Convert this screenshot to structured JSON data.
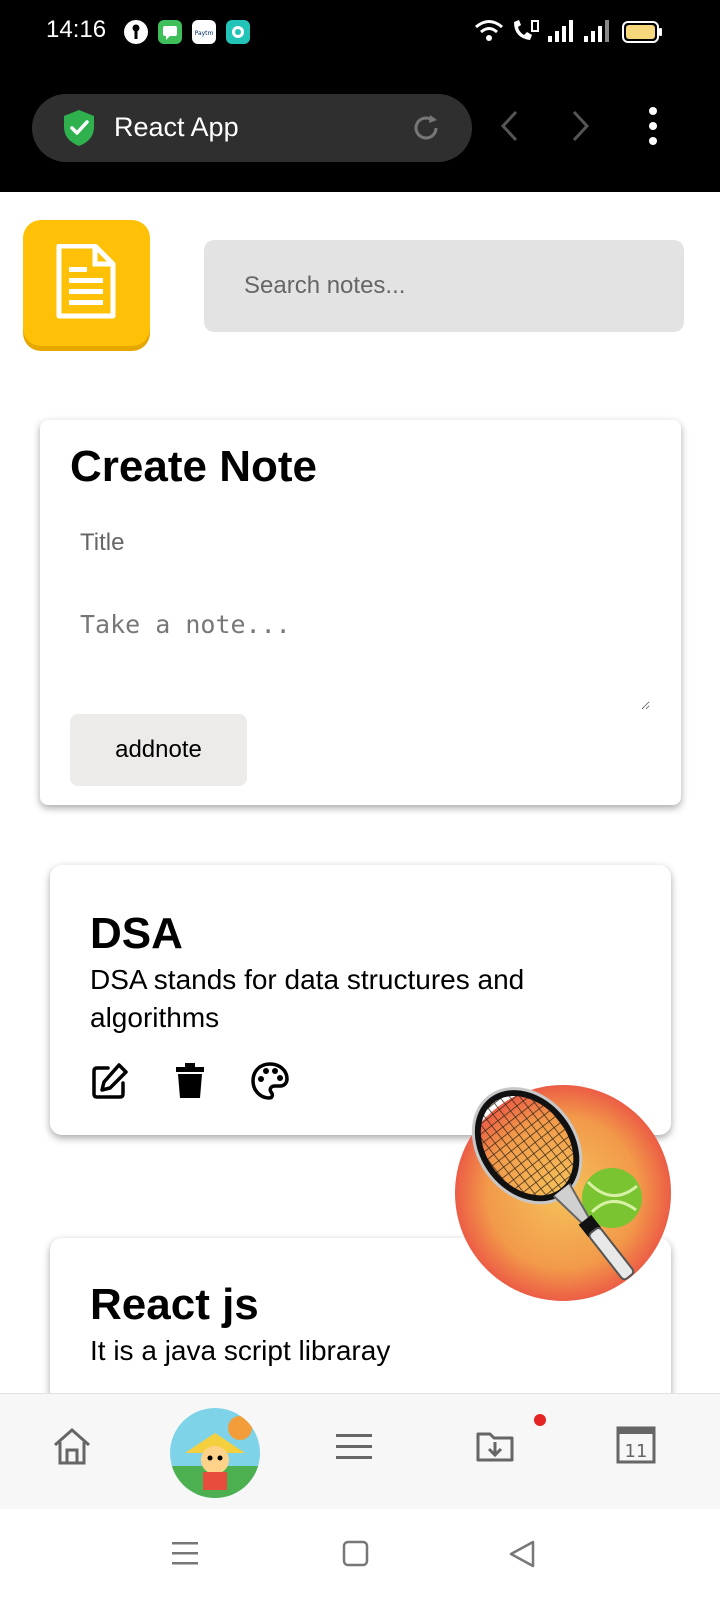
{
  "status_bar": {
    "time": "14:16",
    "notification_apps": [
      "key-icon",
      "messages-icon",
      "paytm-icon",
      "camera-app-icon"
    ],
    "paytm_label": "Paytm",
    "indicators": [
      "wifi-icon",
      "volte-call-icon",
      "signal-icon",
      "signal-icon",
      "battery-icon"
    ]
  },
  "browser": {
    "tab_title": "React App",
    "secure_icon": "shield-check-icon",
    "reload_icon": "reload-icon",
    "back_icon": "chevron-left-icon",
    "forward_icon": "chevron-right-icon",
    "menu_icon": "more-vert-icon"
  },
  "app": {
    "logo_icon": "document-icon",
    "logo_color": "#ffc107",
    "search": {
      "placeholder": "Search notes...",
      "value": ""
    }
  },
  "create_note": {
    "heading": "Create Note",
    "title_placeholder": "Title",
    "note_placeholder": "Take a note...",
    "button_label": "addnote"
  },
  "notes": [
    {
      "title": "DSA",
      "body": "DSA stands for data structures and algorithms",
      "actions": [
        "edit-icon",
        "trash-icon",
        "palette-icon"
      ]
    },
    {
      "title": "React js",
      "body": "It is a java script libraray"
    }
  ],
  "floating_badge": {
    "icon": "tennis-racket-icon",
    "colors": {
      "ring": "#f0624e",
      "center": "#f5b553",
      "ball": "#7ac431"
    }
  },
  "bottom_nav": {
    "items": [
      "home-icon",
      "game-avatar-icon",
      "hamburger-menu-icon",
      "download-folder-icon",
      "calendar-icon"
    ],
    "calendar_day": "11",
    "notification_dot_color": "#e52424"
  },
  "system_nav": [
    "recents-icon",
    "home-square-icon",
    "back-triangle-icon"
  ]
}
